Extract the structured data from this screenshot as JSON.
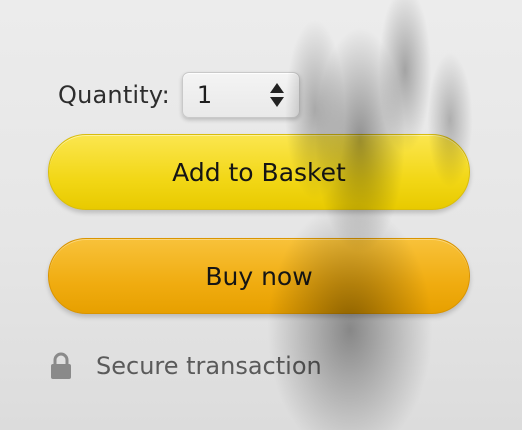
{
  "quantity": {
    "label": "Quantity:",
    "value": "1",
    "icon": "stepper-updown-icon"
  },
  "buttons": {
    "add_to_basket": "Add to Basket",
    "buy_now": "Buy now"
  },
  "secure": {
    "icon": "lock-icon",
    "text": "Secure transaction"
  },
  "colors": {
    "add_to_basket": "#f2d716",
    "buy_now": "#f0ac10",
    "background": "#e8e8e8"
  }
}
